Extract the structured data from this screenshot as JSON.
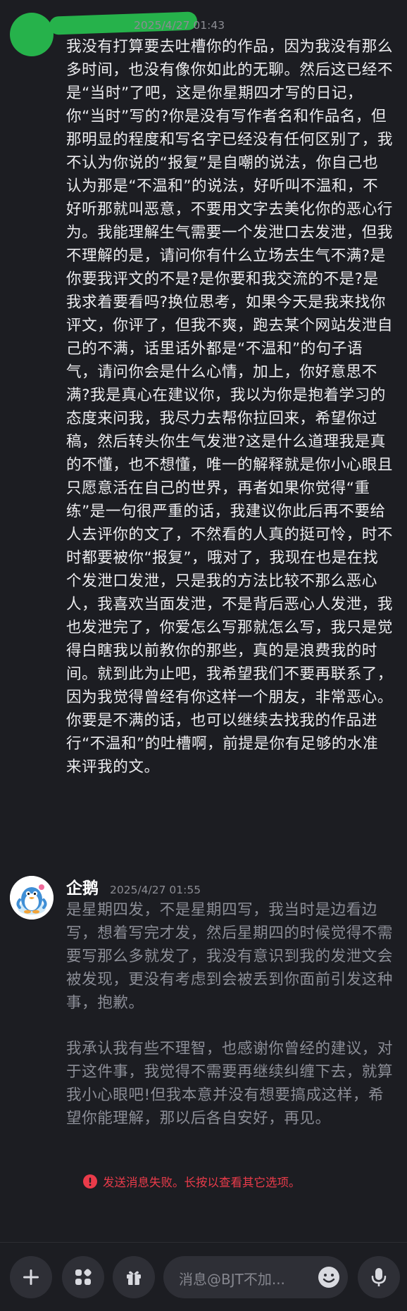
{
  "messages": [
    {
      "author": "",
      "timestamp": "2025/4/27 01:43",
      "avatar_color": "#26b24b",
      "paragraphs": [
        "我没有打算要去吐槽你的作品，因为我没有那么多时间，也没有像你如此的无聊。然后这已经不是“当时”了吧，这是你星期四才写的日记，你“当时”写的?你是没有写作者名和作品名，但那明显的程度和写名字已经没有任何区别了，我不认为你说的“报复”是自嘲的说法，你自己也认为那是“不温和”的说法，好听叫不温和，不好听那就叫恶意，不要用文字去美化你的恶心行为。我能理解生气需要一个发泄口去发泄，但我不理解的是，请问你有什么立场去生气不满?是你要我评文的不是?是你要和我交流的不是?是我求着要看吗?换位思考，如果今天是我来找你评文，你评了，但我不爽，跑去某个网站发泄自己的不满，话里话外都是“不温和”的句子语气，请问你会是什么心情，加上，你好意思不满?我是真心在建议你，我以为你是抱着学习的态度来问我，我尽力去帮你拉回来，希望你过稿，然后转头你生气发泄?这是什么道理我是真的不懂，也不想懂，唯一的解释就是你小心眼且只愿意活在自己的世界，再者如果你觉得“重练”是一句很严重的话，我建议你此后再不要给人去评你的文了，不然看的人真的挺可怜，时不时都要被你“报复”，哦对了，我现在也是在找个发泄口发泄，只是我的方法比较不那么恶心人，我喜欢当面发泄，不是背后恶心人发泄，我也发泄完了，你爱怎么写那就怎么写，我只是觉得白瞎我以前教你的那些，真的是浪费我的时间。就到此为止吧，我希望我们不要再联系了，因为我觉得曾经有你这样一个朋友，非常恶心。",
        "你要是不满的话，也可以继续去找我的作品进行“不温和”的吐槽啊，前提是你有足够的水准来评我的文。"
      ]
    },
    {
      "author": "企鹅",
      "timestamp": "2025/4/27 01:55",
      "avatar_icon": "penguin-avatar",
      "paragraphs": [
        "是星期四发，不是星期四写，我当时是边看边写，想着写完才发，然后星期四的时候觉得不需要写那么多就发了，我没有意识到我的发泄文会被发现，更没有考虑到会被丢到你面前引发这种事，抱歉。",
        "我承认我有些不理智，也感谢你曾经的建议，对于这件事，我觉得不需要再继续纠缠下去，就算我小心眼吧!但我本意并没有想要搞成这样，希望你能理解，那以后各自安好，再见。"
      ],
      "status": "send-failed"
    }
  ],
  "error_message": "发送消息失败。长按以查看其它选项。",
  "error_color": "#ea3b4a",
  "input": {
    "placeholder": "消息@BJT不加..."
  },
  "toolbar": {
    "icons": [
      "plus-icon",
      "apps-icon",
      "gift-icon",
      "emoji-icon",
      "microphone-icon"
    ]
  },
  "colors": {
    "background": "#1c1d22",
    "button_bg": "#2e2f36",
    "own_text": "#ececef",
    "failed_text": "#8b8d96"
  }
}
